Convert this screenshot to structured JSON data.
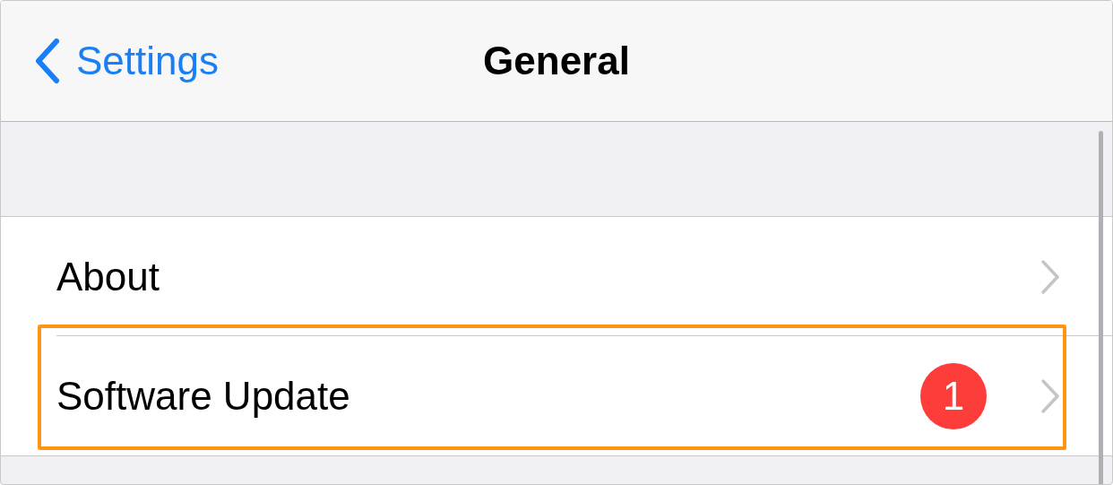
{
  "nav": {
    "back_label": "Settings",
    "title": "General"
  },
  "rows": [
    {
      "label": "About",
      "highlighted": false
    },
    {
      "label": "Software Update",
      "badge": "1",
      "highlighted": true
    }
  ]
}
